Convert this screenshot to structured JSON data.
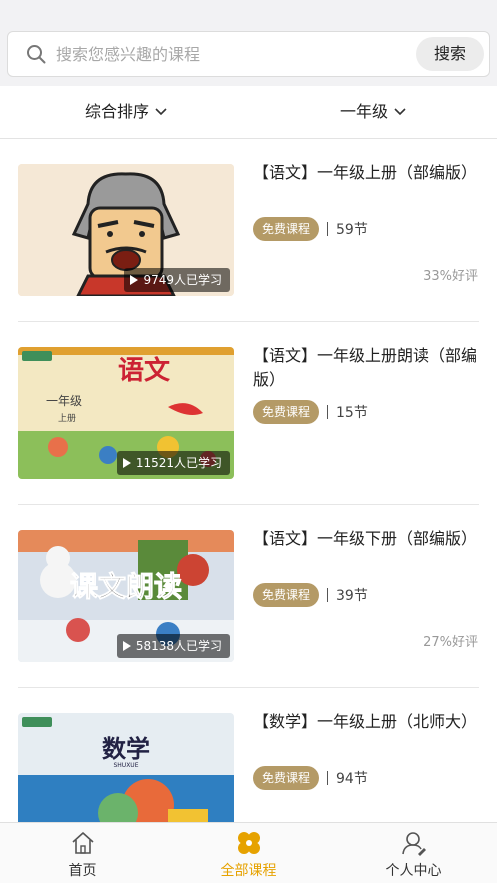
{
  "search": {
    "placeholder": "搜索您感兴趣的课程",
    "button_label": "搜索"
  },
  "filters": {
    "sort_label": "综合排序",
    "grade_label": "一年级"
  },
  "courses": [
    {
      "title": "【语文】一年级上册（部编版）",
      "tag": "免费课程",
      "lessons": "59节",
      "views": "9749人已学习",
      "rating": "33%好评"
    },
    {
      "title": "【语文】一年级上册朗读（部编版）",
      "tag": "免费课程",
      "lessons": "15节",
      "views": "11521人已学习",
      "rating": ""
    },
    {
      "title": "【语文】一年级下册（部编版）",
      "tag": "免费课程",
      "lessons": "39节",
      "views": "58138人已学习",
      "rating": "27%好评"
    },
    {
      "title": "【数学】一年级上册（北师大）",
      "tag": "免费课程",
      "lessons": "94节",
      "views": "",
      "rating": ""
    }
  ],
  "thumbnails": {
    "c2_title": "语文",
    "c2_grade": "一年级",
    "c2_vol": "上册",
    "c3_overlay": "课文朗读",
    "c4_title": "数学",
    "c4_sub": "SHUXUE"
  },
  "tabbar": {
    "home_label": "首页",
    "all_label": "全部课程",
    "me_label": "个人中心"
  },
  "colors": {
    "accent": "#e6a200",
    "tag": "#b49a66"
  }
}
